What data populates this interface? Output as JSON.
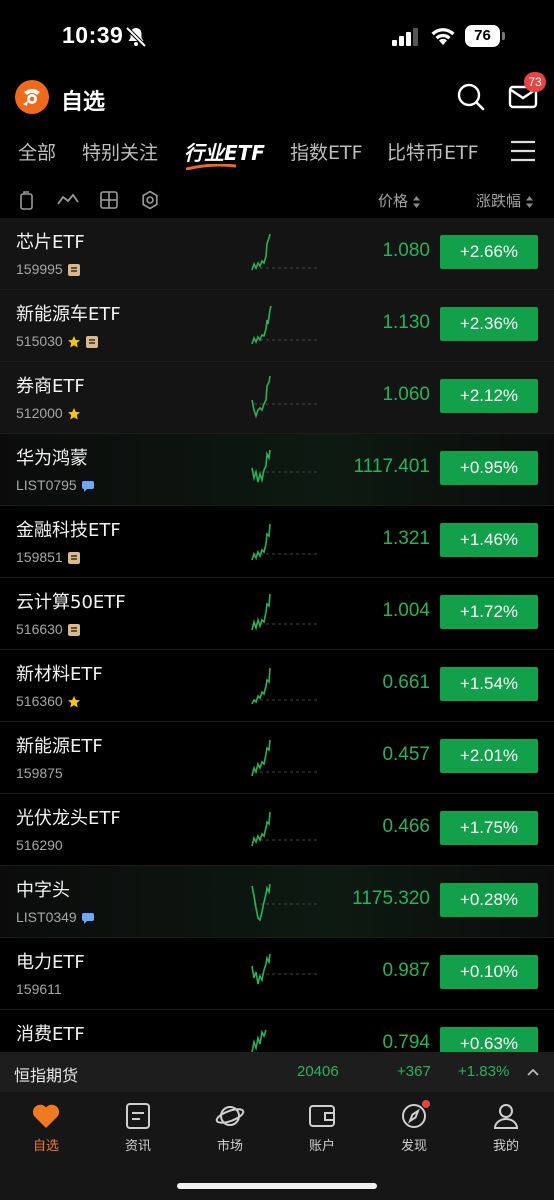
{
  "status_bar": {
    "time": "10:39",
    "battery": "76"
  },
  "header": {
    "title": "自选",
    "mail_badge": "73"
  },
  "tabs": [
    {
      "label": "全部",
      "active": false
    },
    {
      "label": "特别关注",
      "active": false
    },
    {
      "label": "行业ETF",
      "active": true
    },
    {
      "label": "指数ETF",
      "active": false
    },
    {
      "label": "比特币ETF",
      "active": false
    }
  ],
  "toolbar": {
    "price_label": "价格",
    "change_label": "涨跌幅"
  },
  "rows": [
    {
      "name": "芯片ETF",
      "code": "159995",
      "mark": "note-icon",
      "price": "1.080",
      "change": "+2.66%"
    },
    {
      "name": "新能源车ETF",
      "code": "515030",
      "mark": "star-note",
      "price": "1.130",
      "change": "+2.36%"
    },
    {
      "name": "券商ETF",
      "code": "512000",
      "mark": "star-icon",
      "price": "1.060",
      "change": "+2.12%"
    },
    {
      "name": "华为鸿蒙",
      "code": "LIST0795",
      "mark": "chat-icon",
      "price": "1117.401",
      "change": "+0.95%"
    },
    {
      "name": "金融科技ETF",
      "code": "159851",
      "mark": "note-icon",
      "price": "1.321",
      "change": "+1.46%"
    },
    {
      "name": "云计算50ETF",
      "code": "516630",
      "mark": "note-icon",
      "price": "1.004",
      "change": "+1.72%"
    },
    {
      "name": "新材料ETF",
      "code": "516360",
      "mark": "star-icon",
      "price": "0.661",
      "change": "+1.54%"
    },
    {
      "name": "新能源ETF",
      "code": "159875",
      "mark": "",
      "price": "0.457",
      "change": "+2.01%"
    },
    {
      "name": "光伏龙头ETF",
      "code": "516290",
      "mark": "",
      "price": "0.466",
      "change": "+1.75%"
    },
    {
      "name": "中字头",
      "code": "LIST0349",
      "mark": "chat-icon",
      "price": "1175.320",
      "change": "+0.28%"
    },
    {
      "name": "电力ETF",
      "code": "159611",
      "mark": "",
      "price": "0.987",
      "change": "+0.10%"
    },
    {
      "name": "消费ETF",
      "code": "",
      "mark": "",
      "price": "0.794",
      "change": "+0.63%"
    }
  ],
  "ticker": {
    "name": "恒指期货",
    "value": "20406",
    "change": "+367",
    "percent": "+1.83%"
  },
  "bottom_nav": [
    {
      "label": "自选",
      "icon": "heart-icon",
      "active": true
    },
    {
      "label": "资讯",
      "icon": "news-icon",
      "active": false
    },
    {
      "label": "市场",
      "icon": "planet-icon",
      "active": false
    },
    {
      "label": "账户",
      "icon": "wallet-icon",
      "active": false
    },
    {
      "label": "发现",
      "icon": "compass-icon",
      "active": false
    },
    {
      "label": "我的",
      "icon": "person-icon",
      "active": false
    }
  ],
  "colors": {
    "up_green": "#12a04b",
    "accent_orange": "#ef6a1a",
    "badge_red": "#e54545"
  }
}
